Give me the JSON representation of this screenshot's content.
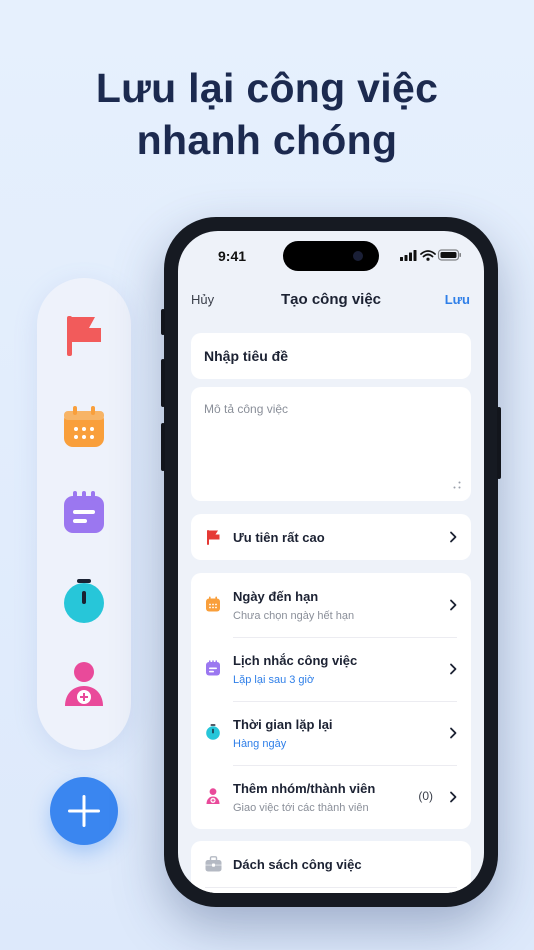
{
  "headline": {
    "line1": "Lưu lại công việc",
    "line2": "nhanh chóng"
  },
  "palette": {
    "icons": [
      "flag-icon",
      "calendar-icon",
      "reminder-icon",
      "timer-icon",
      "add-member-icon"
    ],
    "colors": {
      "flag": "#f25b5b",
      "calendar": "#f99f3b",
      "reminder": "#9b77f0",
      "timer": "#27c6d9",
      "member": "#e94a9a"
    }
  },
  "fab": {
    "icon": "plus-icon",
    "color": "#3a86f0"
  },
  "status": {
    "time": "9:41"
  },
  "nav": {
    "cancel": "Hủy",
    "title": "Tạo công việc",
    "save": "Lưu"
  },
  "form": {
    "title_placeholder": "Nhập tiêu đề",
    "description_placeholder": "Mô tả công việc",
    "priority": {
      "label": "Ưu tiên rất cao",
      "icon": "flag-icon"
    },
    "items": [
      {
        "title": "Ngày đến hạn",
        "subtitle": "Chưa chọn ngày hết hạn",
        "subtitle_color": "#8a8f99",
        "icon": "calendar-icon"
      },
      {
        "title": "Lịch nhắc công việc",
        "subtitle": "Lặp lại sau 3 giờ",
        "subtitle_color": "#2f7fe8",
        "icon": "reminder-icon"
      },
      {
        "title": "Thời gian lặp lại",
        "subtitle": "Hàng ngày",
        "subtitle_color": "#2f7fe8",
        "icon": "timer-icon"
      },
      {
        "title": "Thêm nhóm/thành viên",
        "subtitle": "Giao việc tới các thành viên",
        "subtitle_color": "#8a8f99",
        "icon": "add-member-icon",
        "count": "(0)"
      }
    ],
    "task_list": {
      "label": "Dách sách công việc",
      "icon": "briefcase-icon"
    }
  },
  "accent": "#2f7fe8"
}
